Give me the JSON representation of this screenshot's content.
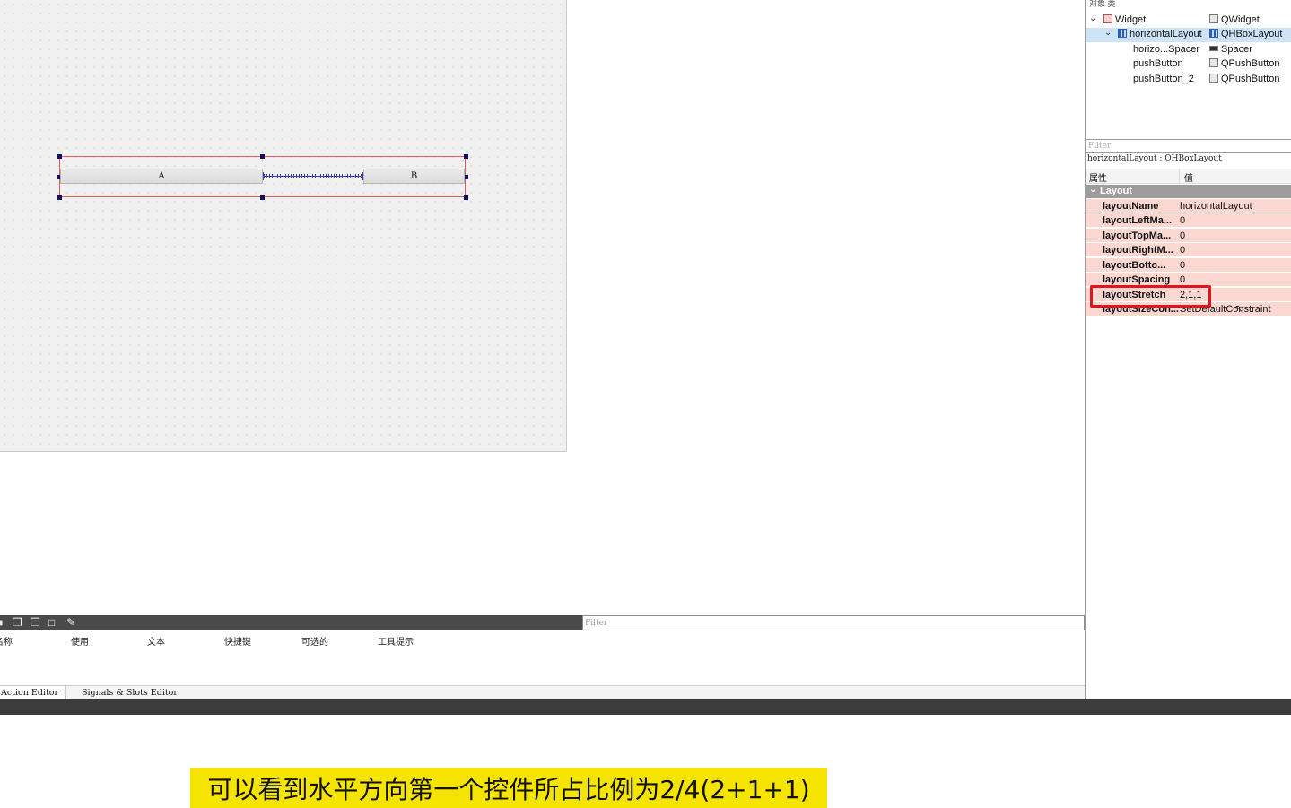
{
  "canvas": {
    "button_a": "A",
    "button_b": "B"
  },
  "object_inspector": {
    "header": "对象          类",
    "tree": [
      {
        "name": "Widget",
        "class": "QWidget",
        "icon": "widget-icon"
      },
      {
        "name": "horizontalLayout",
        "class": "QHBoxLayout",
        "icon": "layout-icon"
      },
      {
        "name": "horizo...Spacer",
        "class": "Spacer",
        "icon": "spacer-icon"
      },
      {
        "name": "pushButton",
        "class": "QPushButton",
        "icon": "pushbutton-icon"
      },
      {
        "name": "pushButton_2",
        "class": "QPushButton",
        "icon": "pushbutton-icon"
      }
    ]
  },
  "property_editor": {
    "filter_placeholder": "Filter",
    "object_info": "horizontalLayout : QHBoxLayout",
    "col_property": "属性",
    "col_value": "值",
    "group": "Layout",
    "rows": [
      {
        "key": "layoutName",
        "value": "horizontalLayout"
      },
      {
        "key": "layoutLeftMa...",
        "value": "0"
      },
      {
        "key": "layoutTopMa...",
        "value": "0"
      },
      {
        "key": "layoutRightM...",
        "value": "0"
      },
      {
        "key": "layoutBotto...",
        "value": "0"
      },
      {
        "key": "layoutSpacing",
        "value": "0"
      },
      {
        "key": "layoutStretch",
        "value": "2,1,1"
      },
      {
        "key": "layoutSizeCon...",
        "value": "SetDefaultConstraint"
      }
    ]
  },
  "action_editor": {
    "filter_placeholder": "Filter",
    "columns": [
      "名称",
      "使用",
      "文本",
      "快捷键",
      "可选的",
      "工具提示"
    ],
    "tabs": [
      "Action Editor",
      "Signals & Slots Editor"
    ]
  },
  "subtitle": "可以看到水平方向第一个控件所占比例为2/4(2+1+1)",
  "colors": {
    "highlight": "#e3141c",
    "property_row": "#fbd7d2",
    "subtitle_bg": "#f5e400"
  }
}
